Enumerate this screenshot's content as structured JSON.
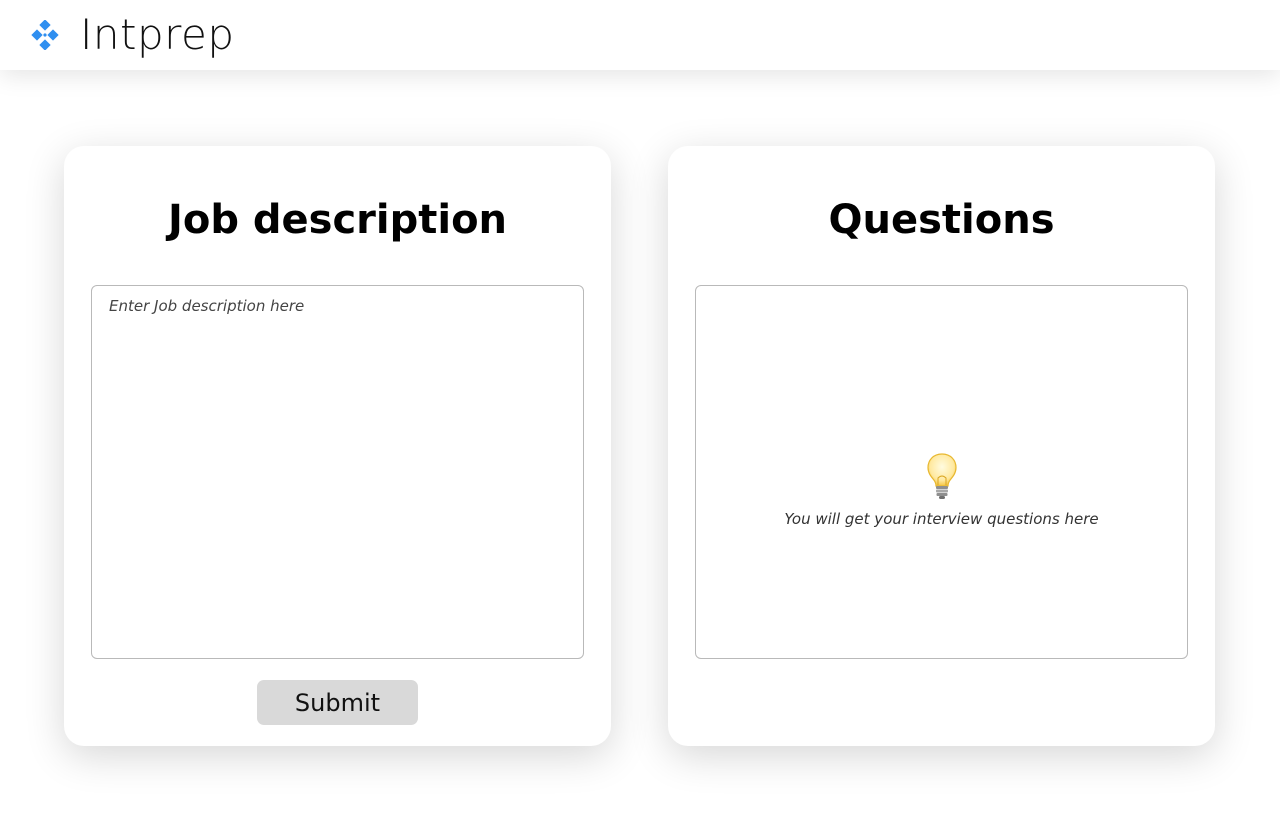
{
  "header": {
    "brand": "Intprep",
    "logo_icon": "diamond-grid-icon",
    "accent_color": "#2f8ff0"
  },
  "job_panel": {
    "title": "Job description",
    "input_value": "",
    "input_placeholder": "Enter Job description here",
    "submit_label": "Submit"
  },
  "questions_panel": {
    "title": "Questions",
    "empty_icon": "lightbulb-icon",
    "empty_message": "You will get your interview questions here"
  }
}
